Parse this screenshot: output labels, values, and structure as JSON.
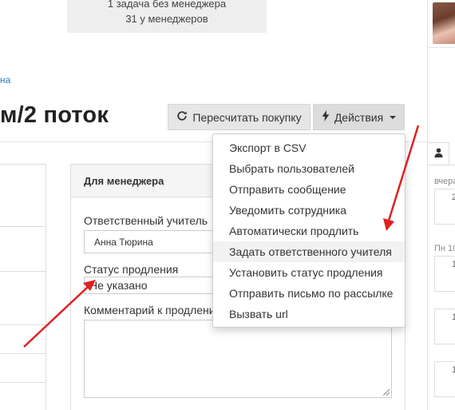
{
  "stats": {
    "line1": "1 задача без менеджера",
    "line2": "31 у менеджеров"
  },
  "breadcrumb": {
    "link": "на"
  },
  "page": {
    "title": "м/2 поток"
  },
  "toolbar": {
    "recalc_label": "Пересчитать покупку",
    "actions_label": "Действия"
  },
  "manager_panel": {
    "title": "Для менеджера",
    "teacher_label": "Ответственный учитель",
    "teacher_value": "Анна Тюрина",
    "renewal_label": "Статус продления",
    "renewal_value": "Не указано",
    "comment_label": "Комментарий к продлению"
  },
  "actions_menu": {
    "items": [
      "Экспорт в CSV",
      "Выбрать пользователей",
      "Отправить сообщение",
      "Уведомить сотрудника",
      "Автоматически продлить",
      "Задать ответственного учителя",
      "Установить статус продления",
      "Отправить письмо по рассылке",
      "Вызвать url"
    ],
    "active_index": 5
  },
  "right_sidebar": {
    "label_yesterday": "вчера",
    "label_mon": "Пн 10",
    "card1": "2",
    "card2": "1",
    "card3": "1",
    "card4": "1"
  },
  "colors": {
    "link": "#337ab7",
    "annotation_arrow": "#e02020",
    "button_bg": "#e6e6e6"
  },
  "icons": {
    "recalc": "refresh-icon",
    "actions": "bolt-icon",
    "tab": "user-icon"
  }
}
